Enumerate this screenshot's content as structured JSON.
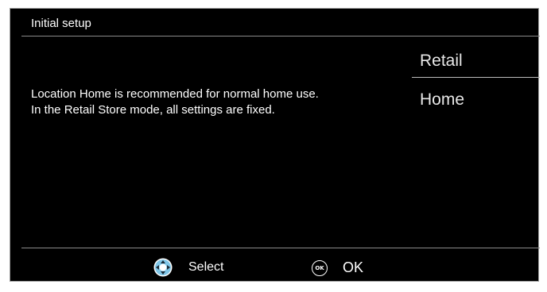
{
  "header": {
    "title": "Initial setup"
  },
  "main": {
    "description_line1": "Location Home is recommended for normal home use.",
    "description_line2": "In the Retail Store mode, all settings are fixed."
  },
  "options": {
    "items": [
      {
        "label": "Retail",
        "selected": true
      },
      {
        "label": "Home",
        "selected": false
      }
    ]
  },
  "footer": {
    "select_label": "Select",
    "ok_icon_text": "OK",
    "ok_label": "OK"
  },
  "colors": {
    "background": "#000000",
    "text": "#ffffff",
    "nav_icon_fill": "#7fc6e8"
  }
}
